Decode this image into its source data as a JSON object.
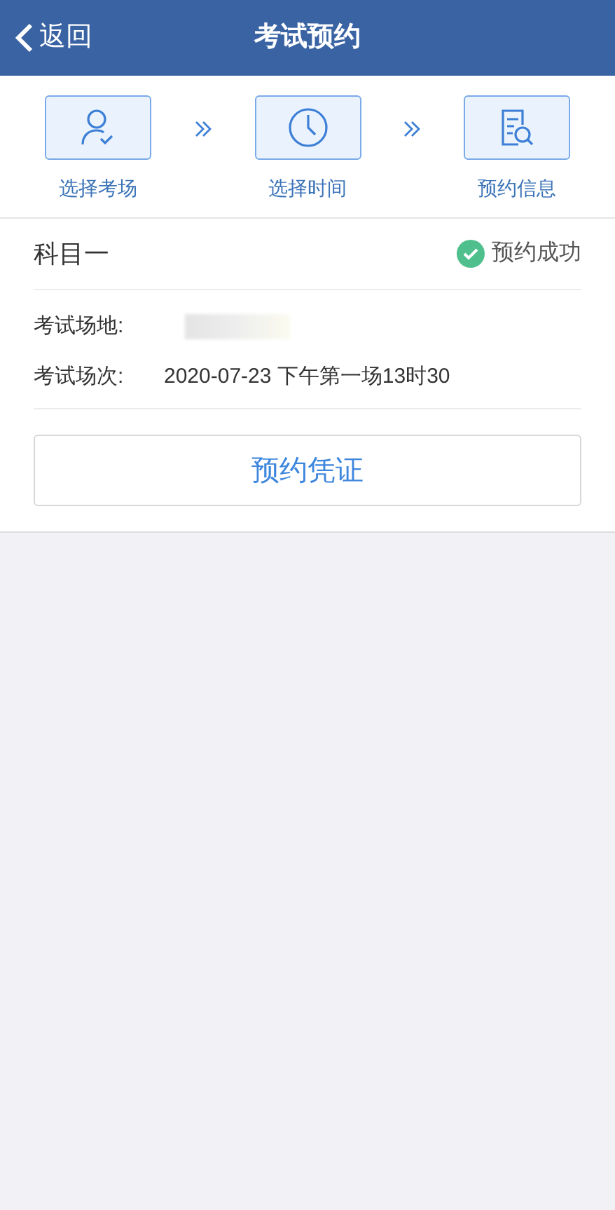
{
  "header": {
    "back": "返回",
    "title": "考试预约"
  },
  "steps": [
    {
      "kind": "person",
      "label": "选择考场"
    },
    {
      "kind": "clock",
      "label": "选择时间"
    },
    {
      "kind": "document",
      "label": "预约信息"
    }
  ],
  "subject": {
    "name": "科目一",
    "status": "预约成功"
  },
  "details": [
    {
      "label": "考试场地:",
      "kind": "blurred"
    },
    {
      "label": "考试场次:",
      "value": "2020-07-23 下午第一场13时30",
      "kind": "text"
    }
  ],
  "button": "预约凭证"
}
